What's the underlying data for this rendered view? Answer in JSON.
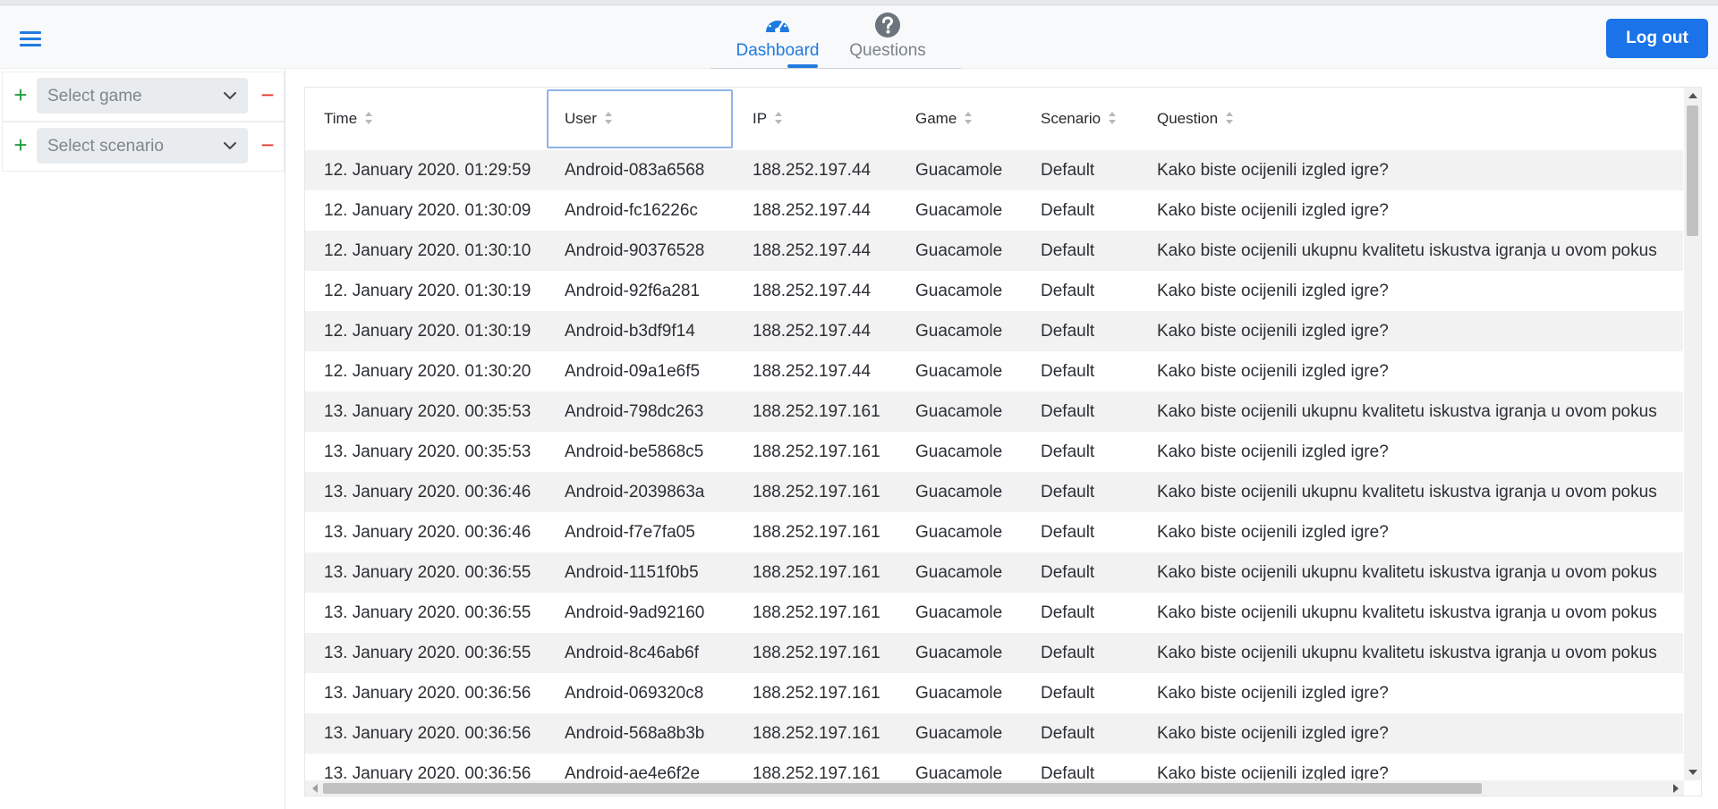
{
  "colors": {
    "accent": "#1a73e8",
    "add": "#1e9e3e",
    "remove": "#e0362c",
    "row_stripe": "#f2f2f2"
  },
  "navbar": {
    "menu_icon": "hamburger-icon",
    "tabs": [
      {
        "label": "Dashboard",
        "icon": "speedometer-icon",
        "active": true
      },
      {
        "label": "Questions",
        "icon": "question-circle-icon",
        "active": false
      }
    ],
    "logout_label": "Log out"
  },
  "sidebar": {
    "filters": [
      {
        "placeholder": "Select game",
        "add": "+",
        "remove": "−"
      },
      {
        "placeholder": "Select scenario",
        "add": "+",
        "remove": "−"
      }
    ]
  },
  "table": {
    "columns": [
      "Time",
      "User",
      "IP",
      "Game",
      "Scenario",
      "Question"
    ],
    "rows": [
      [
        "12. January 2020. 01:29:59",
        "Android-083a6568",
        "188.252.197.44",
        "Guacamole",
        "Default",
        "Kako biste ocijenili izgled igre?"
      ],
      [
        "12. January 2020. 01:30:09",
        "Android-fc16226c",
        "188.252.197.44",
        "Guacamole",
        "Default",
        "Kako biste ocijenili izgled igre?"
      ],
      [
        "12. January 2020. 01:30:10",
        "Android-90376528",
        "188.252.197.44",
        "Guacamole",
        "Default",
        "Kako biste ocijenili ukupnu kvalitetu iskustva igranja u ovom pokus"
      ],
      [
        "12. January 2020. 01:30:19",
        "Android-92f6a281",
        "188.252.197.44",
        "Guacamole",
        "Default",
        "Kako biste ocijenili izgled igre?"
      ],
      [
        "12. January 2020. 01:30:19",
        "Android-b3df9f14",
        "188.252.197.44",
        "Guacamole",
        "Default",
        "Kako biste ocijenili izgled igre?"
      ],
      [
        "12. January 2020. 01:30:20",
        "Android-09a1e6f5",
        "188.252.197.44",
        "Guacamole",
        "Default",
        "Kako biste ocijenili izgled igre?"
      ],
      [
        "13. January 2020. 00:35:53",
        "Android-798dc263",
        "188.252.197.161",
        "Guacamole",
        "Default",
        "Kako biste ocijenili ukupnu kvalitetu iskustva igranja u ovom pokus"
      ],
      [
        "13. January 2020. 00:35:53",
        "Android-be5868c5",
        "188.252.197.161",
        "Guacamole",
        "Default",
        "Kako biste ocijenili izgled igre?"
      ],
      [
        "13. January 2020. 00:36:46",
        "Android-2039863a",
        "188.252.197.161",
        "Guacamole",
        "Default",
        "Kako biste ocijenili ukupnu kvalitetu iskustva igranja u ovom pokus"
      ],
      [
        "13. January 2020. 00:36:46",
        "Android-f7e7fa05",
        "188.252.197.161",
        "Guacamole",
        "Default",
        "Kako biste ocijenili izgled igre?"
      ],
      [
        "13. January 2020. 00:36:55",
        "Android-1151f0b5",
        "188.252.197.161",
        "Guacamole",
        "Default",
        "Kako biste ocijenili ukupnu kvalitetu iskustva igranja u ovom pokus"
      ],
      [
        "13. January 2020. 00:36:55",
        "Android-9ad92160",
        "188.252.197.161",
        "Guacamole",
        "Default",
        "Kako biste ocijenili ukupnu kvalitetu iskustva igranja u ovom pokus"
      ],
      [
        "13. January 2020. 00:36:55",
        "Android-8c46ab6f",
        "188.252.197.161",
        "Guacamole",
        "Default",
        "Kako biste ocijenili ukupnu kvalitetu iskustva igranja u ovom pokus"
      ],
      [
        "13. January 2020. 00:36:56",
        "Android-069320c8",
        "188.252.197.161",
        "Guacamole",
        "Default",
        "Kako biste ocijenili izgled igre?"
      ],
      [
        "13. January 2020. 00:36:56",
        "Android-568a8b3b",
        "188.252.197.161",
        "Guacamole",
        "Default",
        "Kako biste ocijenili izgled igre?"
      ],
      [
        "13. January 2020. 00:36:56",
        "Android-ae4e6f2e",
        "188.252.197.161",
        "Guacamole",
        "Default",
        "Kako biste ocijenili izgled igre?"
      ]
    ]
  }
}
